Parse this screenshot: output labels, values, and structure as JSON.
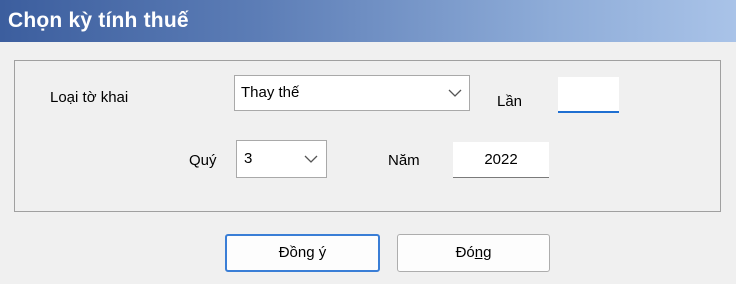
{
  "window": {
    "title": "Chọn kỳ tính thuế"
  },
  "form": {
    "loai_to_khai": {
      "label": "Loại tờ khai",
      "value": "Thay thế"
    },
    "lan": {
      "label": "Lần",
      "value": ""
    },
    "quy": {
      "label": "Quý",
      "value": "3"
    },
    "nam": {
      "label": "Năm",
      "value": "2022"
    }
  },
  "buttons": {
    "ok": {
      "label_before": "Đồn",
      "label_mnemonic": "g",
      "label_after": " ý"
    },
    "close": {
      "label_before": "Đó",
      "label_mnemonic": "ng",
      "label_after": ""
    }
  },
  "icons": {
    "dropdown": "chevron-down-icon"
  },
  "colors": {
    "title_bar_start": "#3c5e9e",
    "title_bar_end": "#a9c3e8",
    "default_button_border": "#3a7ed6",
    "focus_underline": "#1f6fd1"
  }
}
